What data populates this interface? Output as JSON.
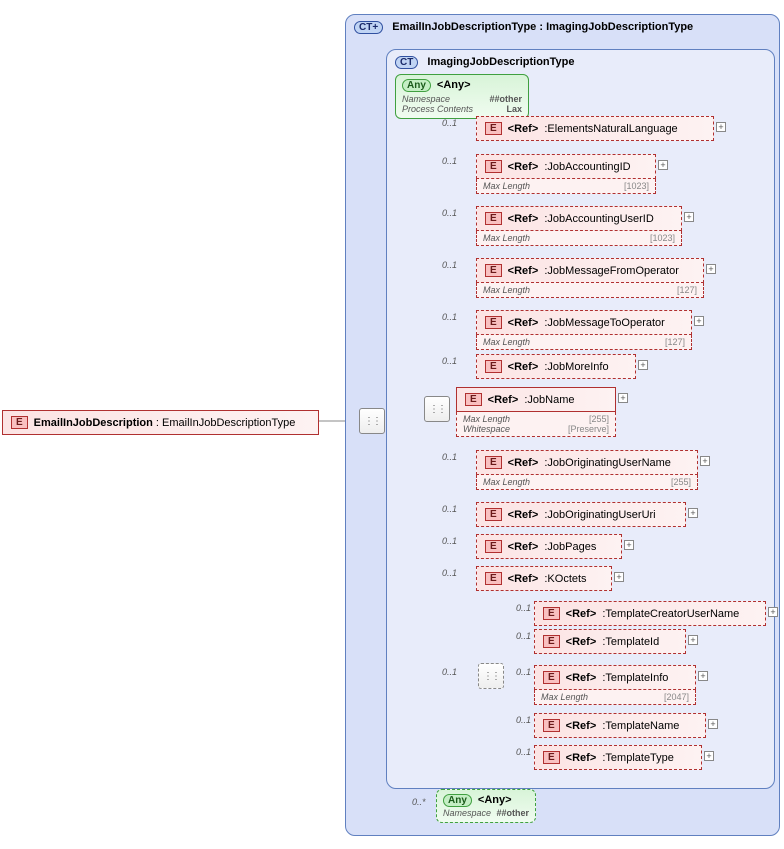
{
  "root": {
    "name": "EmailInJobDescription",
    "type": "EmailInJobDescriptionType"
  },
  "ct_outer": {
    "name": "EmailInJobDescriptionType",
    "base": "ImagingJobDescriptionType"
  },
  "ct_inner": {
    "name": "ImagingJobDescriptionType"
  },
  "any1": {
    "title": "<Any>",
    "ns_label": "Namespace",
    "ns": "##other",
    "pc_label": "Process Contents",
    "pc": "Lax"
  },
  "any2": {
    "title": "<Any>",
    "ns_label": "Namespace",
    "ns": "##other"
  },
  "c": {
    "r01": "0..1",
    "r0s": "0..*"
  },
  "ref": "<Ref>",
  "badge": {
    "e": "E",
    "ct": "CT",
    "ctp": "CT+",
    "any": "Any"
  },
  "facets": {
    "maxlen": "Max Length",
    "ws": "Whitespace",
    "v1023": "[1023]",
    "v127": "[127]",
    "v255": "[255]",
    "v2047": "[2047]",
    "preserve": "[Preserve]"
  },
  "el": {
    "enl": "ElementsNaturalLanguage",
    "jaid": "JobAccountingID",
    "jauid": "JobAccountingUserID",
    "jmfo": "JobMessageFromOperator",
    "jmto": "JobMessageToOperator",
    "jmi": "JobMoreInfo",
    "jn": "JobName",
    "joun": "JobOriginatingUserName",
    "jouu": "JobOriginatingUserUri",
    "jp": "JobPages",
    "ko": "KOctets",
    "tcun": "TemplateCreatorUserName",
    "tid": "TemplateId",
    "tinfo": "TemplateInfo",
    "tname": "TemplateName",
    "ttype": "TemplateType"
  }
}
